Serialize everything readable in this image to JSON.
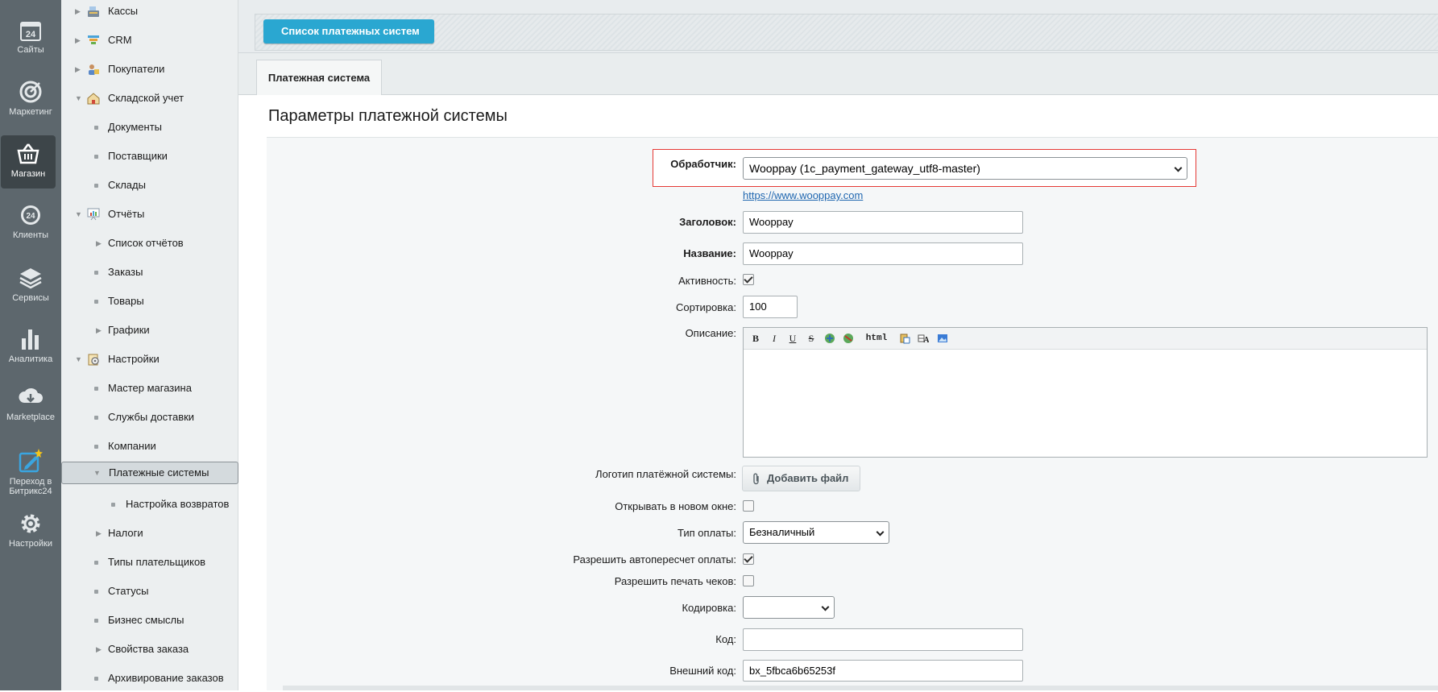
{
  "left_panel": [
    {
      "id": "sites",
      "label": "Сайты",
      "icon": "calendar-24-icon"
    },
    {
      "id": "marketing",
      "label": "Маркетинг",
      "icon": "target-icon"
    },
    {
      "id": "shop",
      "label": "Магазин",
      "icon": "basket-icon",
      "active": true
    },
    {
      "id": "clients",
      "label": "Клиенты",
      "icon": "bitrix24-badge-icon"
    },
    {
      "id": "services",
      "label": "Сервисы",
      "icon": "layers-icon"
    },
    {
      "id": "analytics",
      "label": "Аналитика",
      "icon": "bar-chart-icon"
    },
    {
      "id": "marketplace",
      "label": "Marketplace",
      "icon": "cloud-download-icon"
    },
    {
      "id": "bitrix24",
      "label": "Переход в Битрикс24",
      "icon": "edit-star-icon"
    },
    {
      "id": "settings",
      "label": "Настройки",
      "icon": "gear-icon"
    }
  ],
  "menu": [
    {
      "label": "Кассы",
      "type": "arrow",
      "level": 0,
      "icon": "cash-register-icon"
    },
    {
      "label": "CRM",
      "type": "arrow",
      "level": 0,
      "icon": "crm-icon"
    },
    {
      "label": "Покупатели",
      "type": "arrow",
      "level": 0,
      "icon": "buyers-icon"
    },
    {
      "label": "Складской учет",
      "type": "open",
      "level": 0,
      "icon": "warehouse-icon"
    },
    {
      "label": "Документы",
      "type": "dot",
      "level": 1
    },
    {
      "label": "Поставщики",
      "type": "dot",
      "level": 1
    },
    {
      "label": "Склады",
      "type": "dot",
      "level": 1
    },
    {
      "label": "Отчёты",
      "type": "open",
      "level": 0,
      "icon": "reports-icon"
    },
    {
      "label": "Список отчётов",
      "type": "arrow",
      "level": 1
    },
    {
      "label": "Заказы",
      "type": "dot",
      "level": 1
    },
    {
      "label": "Товары",
      "type": "dot",
      "level": 1
    },
    {
      "label": "Графики",
      "type": "arrow",
      "level": 1
    },
    {
      "label": "Настройки",
      "type": "open",
      "level": 0,
      "icon": "shop-settings-icon"
    },
    {
      "label": "Мастер магазина",
      "type": "dot",
      "level": 1
    },
    {
      "label": "Службы доставки",
      "type": "dot",
      "level": 1
    },
    {
      "label": "Компании",
      "type": "dot",
      "level": 1
    },
    {
      "label": "Платежные системы",
      "type": "open",
      "level": 1,
      "selected": true
    },
    {
      "label": "Настройка возвратов",
      "type": "dot",
      "level": 2
    },
    {
      "label": "Налоги",
      "type": "arrow",
      "level": 1
    },
    {
      "label": "Типы плательщиков",
      "type": "dot",
      "level": 1
    },
    {
      "label": "Статусы",
      "type": "dot",
      "level": 1
    },
    {
      "label": "Бизнес смыслы",
      "type": "dot",
      "level": 1
    },
    {
      "label": "Свойства заказа",
      "type": "arrow",
      "level": 1
    },
    {
      "label": "Архивирование заказов",
      "type": "dot",
      "level": 1
    }
  ],
  "header": {
    "back_button": "Список платежных систем",
    "tab": "Платежная система"
  },
  "form": {
    "title": "Параметры платежной системы",
    "handler_label": "Обработчик:",
    "handler_value": "Wooppay (1c_payment_gateway_utf8-master)",
    "handler_link": "https://www.wooppay.com",
    "heading_label": "Заголовок:",
    "heading_value": "Wooppay",
    "name_label": "Название:",
    "name_value": "Wooppay",
    "active_label": "Активность:",
    "active_checked": true,
    "sort_label": "Сортировка:",
    "sort_value": "100",
    "description_label": "Описание:",
    "editor_html_label": "html",
    "logo_label": "Логотип платёжной системы:",
    "add_file_label": "Добавить файл",
    "new_window_label": "Открывать в новом окне:",
    "new_window_checked": false,
    "pay_type_label": "Тип оплаты:",
    "pay_type_value": "Безналичный",
    "autorecalc_label": "Разрешить автопересчет оплаты:",
    "autorecalc_checked": true,
    "print_checks_label": "Разрешить печать чеков:",
    "print_checks_checked": false,
    "encoding_label": "Кодировка:",
    "encoding_value": "",
    "code_label": "Код:",
    "code_value": "",
    "ext_code_label": "Внешний код:",
    "ext_code_value": "bx_5fbca6b65253f"
  },
  "colors": {
    "accent": "#2aa7d1",
    "highlight_border": "#e53935",
    "left_panel": "#5d676d",
    "menu_bg": "#eceff0"
  }
}
